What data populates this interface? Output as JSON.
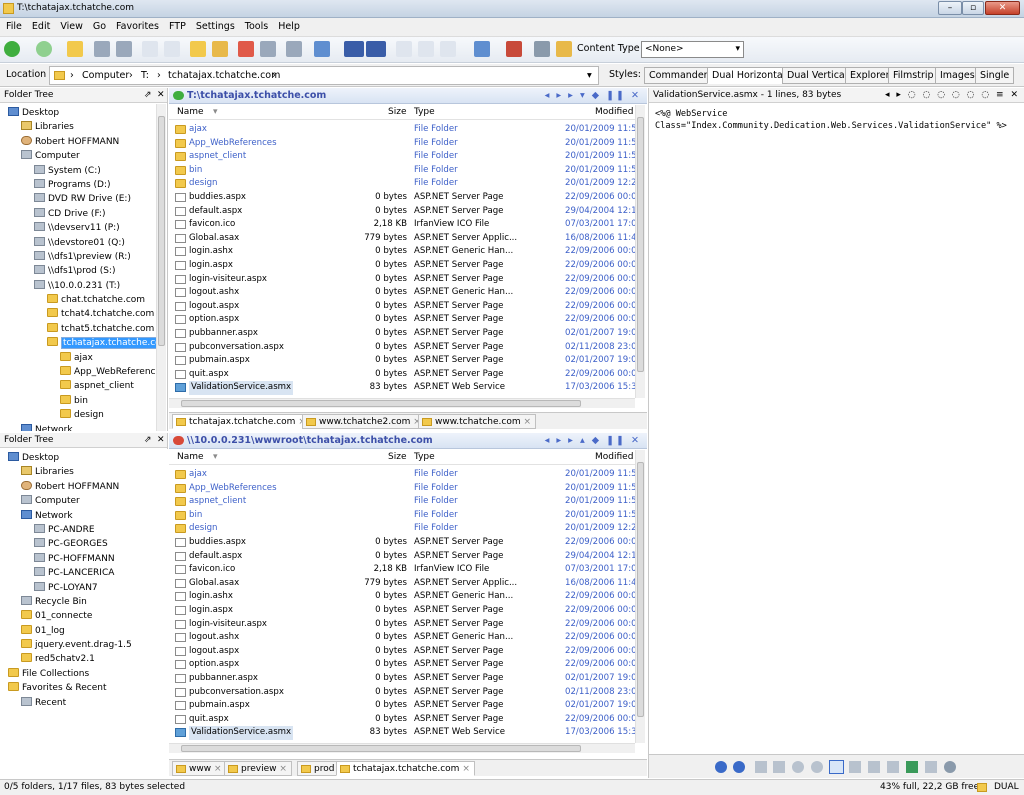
{
  "window": {
    "title": "T:\\tchatajax.tchatche.com",
    "min_label": "–",
    "max_label": "▫",
    "close_label": "✕"
  },
  "menu": [
    "File",
    "Edit",
    "View",
    "Go",
    "Favorites",
    "FTP",
    "Settings",
    "Tools",
    "Help"
  ],
  "toolbar": {
    "content_type_label": "Content Type",
    "content_type_value": "<None>"
  },
  "location": {
    "label": "Location",
    "crumbs": [
      "Computer",
      "T:",
      "tchatajax.tchatche.com"
    ]
  },
  "styles": {
    "label": "Styles:",
    "items": [
      "Commander",
      "Dual Horizontal",
      "Dual Vertical",
      "Explorer",
      "Filmstrip",
      "Images",
      "Single"
    ],
    "active": "Dual Horizontal"
  },
  "tree_top": {
    "title": "Folder Tree",
    "items": [
      {
        "label": "Desktop",
        "icon": "desktop",
        "indent": 0
      },
      {
        "label": "Libraries",
        "icon": "library",
        "indent": 1
      },
      {
        "label": "Robert HOFFMANN",
        "icon": "user",
        "indent": 1
      },
      {
        "label": "Computer",
        "icon": "computer",
        "indent": 1
      },
      {
        "label": "System (C:)",
        "icon": "drive",
        "indent": 2
      },
      {
        "label": "Programs (D:)",
        "icon": "drive",
        "indent": 2
      },
      {
        "label": "DVD RW Drive (E:)",
        "icon": "drive",
        "indent": 2
      },
      {
        "label": "CD Drive (F:)",
        "icon": "drive",
        "indent": 2
      },
      {
        "label": "\\\\devserv11 (P:)",
        "icon": "network-drive",
        "indent": 2
      },
      {
        "label": "\\\\devstore01 (Q:)",
        "icon": "network-drive",
        "indent": 2
      },
      {
        "label": "\\\\dfs1\\preview (R:)",
        "icon": "network-drive",
        "indent": 2
      },
      {
        "label": "\\\\dfs1\\prod (S:)",
        "icon": "network-drive",
        "indent": 2
      },
      {
        "label": "\\\\10.0.0.231 (T:)",
        "icon": "network-drive",
        "indent": 2
      },
      {
        "label": "chat.tchatche.com",
        "icon": "folder",
        "indent": 3
      },
      {
        "label": "tchat4.tchatche.com",
        "icon": "folder",
        "indent": 3
      },
      {
        "label": "tchat5.tchatche.com",
        "icon": "folder",
        "indent": 3
      },
      {
        "label": "tchatajax.tchatche.com",
        "icon": "folder",
        "indent": 3,
        "selected": true
      },
      {
        "label": "ajax",
        "icon": "folder",
        "indent": 4
      },
      {
        "label": "App_WebReferences",
        "icon": "folder",
        "indent": 4
      },
      {
        "label": "aspnet_client",
        "icon": "folder",
        "indent": 4
      },
      {
        "label": "bin",
        "icon": "folder",
        "indent": 4
      },
      {
        "label": "design",
        "icon": "folder",
        "indent": 4
      },
      {
        "label": "Network",
        "icon": "network",
        "indent": 1
      }
    ]
  },
  "tree_bottom": {
    "title": "Folder Tree",
    "items": [
      {
        "label": "Desktop",
        "icon": "desktop",
        "indent": 0
      },
      {
        "label": "Libraries",
        "icon": "library",
        "indent": 1
      },
      {
        "label": "Robert HOFFMANN",
        "icon": "user",
        "indent": 1
      },
      {
        "label": "Computer",
        "icon": "computer",
        "indent": 1
      },
      {
        "label": "Network",
        "icon": "network",
        "indent": 1
      },
      {
        "label": "PC-ANDRE",
        "icon": "computer",
        "indent": 2
      },
      {
        "label": "PC-GEORGES",
        "icon": "computer",
        "indent": 2
      },
      {
        "label": "PC-HOFFMANN",
        "icon": "computer",
        "indent": 2
      },
      {
        "label": "PC-LANCERICA",
        "icon": "computer",
        "indent": 2
      },
      {
        "label": "PC-LOYAN7",
        "icon": "computer",
        "indent": 2
      },
      {
        "label": "Recycle Bin",
        "icon": "recycle",
        "indent": 1
      },
      {
        "label": "01_connecte",
        "icon": "folder",
        "indent": 1
      },
      {
        "label": "01_log",
        "icon": "folder",
        "indent": 1
      },
      {
        "label": "jquery.event.drag-1.5",
        "icon": "folder",
        "indent": 1
      },
      {
        "label": "red5chatv2.1",
        "icon": "folder",
        "indent": 1
      },
      {
        "label": "File Collections",
        "icon": "folder",
        "indent": 0
      },
      {
        "label": "Favorites & Recent",
        "icon": "star",
        "indent": 0
      },
      {
        "label": "Recent",
        "icon": "recent",
        "indent": 1
      }
    ]
  },
  "columns": {
    "name": "Name",
    "size": "Size",
    "type": "Type",
    "modified": "Modified"
  },
  "pane_top": {
    "path": "T:\\tchatajax.tchatche.com",
    "tabs": [
      "tchatajax.tchatche.com",
      "www.tchatche2.com",
      "www.tchatche.com"
    ],
    "active_tab": 0
  },
  "pane_bottom": {
    "path": "\\\\10.0.0.231\\wwwroot\\tchatajax.tchatche.com",
    "tabs": [
      "www",
      "preview",
      "prod",
      "tchatajax.tchatche.com"
    ],
    "active_tab": 3
  },
  "files": [
    {
      "name": "ajax",
      "size": "",
      "type": "File Folder",
      "modified": "20/01/2009 11:5",
      "folder": true
    },
    {
      "name": "App_WebReferences",
      "size": "",
      "type": "File Folder",
      "modified": "20/01/2009 11:5",
      "folder": true
    },
    {
      "name": "aspnet_client",
      "size": "",
      "type": "File Folder",
      "modified": "20/01/2009 11:5",
      "folder": true
    },
    {
      "name": "bin",
      "size": "",
      "type": "File Folder",
      "modified": "20/01/2009 11:5",
      "folder": true
    },
    {
      "name": "design",
      "size": "",
      "type": "File Folder",
      "modified": "20/01/2009 12:2",
      "folder": true
    },
    {
      "name": "buddies.aspx",
      "size": "0 bytes",
      "type": "ASP.NET Server Page",
      "modified": "22/09/2006 00:0"
    },
    {
      "name": "default.aspx",
      "size": "0 bytes",
      "type": "ASP.NET Server Page",
      "modified": "29/04/2004 12:1"
    },
    {
      "name": "favicon.ico",
      "size": "2,18 KB",
      "type": "IrfanView ICO File",
      "modified": "07/03/2001 17:0"
    },
    {
      "name": "Global.asax",
      "size": "779 bytes",
      "type": "ASP.NET Server Applic...",
      "modified": "16/08/2006 11:4"
    },
    {
      "name": "login.ashx",
      "size": "0 bytes",
      "type": "ASP.NET Generic Han...",
      "modified": "22/09/2006 00:0"
    },
    {
      "name": "login.aspx",
      "size": "0 bytes",
      "type": "ASP.NET Server Page",
      "modified": "22/09/2006 00:0"
    },
    {
      "name": "login-visiteur.aspx",
      "size": "0 bytes",
      "type": "ASP.NET Server Page",
      "modified": "22/09/2006 00:0"
    },
    {
      "name": "logout.ashx",
      "size": "0 bytes",
      "type": "ASP.NET Generic Han...",
      "modified": "22/09/2006 00:0"
    },
    {
      "name": "logout.aspx",
      "size": "0 bytes",
      "type": "ASP.NET Server Page",
      "modified": "22/09/2006 00:0"
    },
    {
      "name": "option.aspx",
      "size": "0 bytes",
      "type": "ASP.NET Server Page",
      "modified": "22/09/2006 00:0"
    },
    {
      "name": "pubbanner.aspx",
      "size": "0 bytes",
      "type": "ASP.NET Server Page",
      "modified": "02/01/2007 19:0"
    },
    {
      "name": "pubconversation.aspx",
      "size": "0 bytes",
      "type": "ASP.NET Server Page",
      "modified": "02/11/2008 23:0"
    },
    {
      "name": "pubmain.aspx",
      "size": "0 bytes",
      "type": "ASP.NET Server Page",
      "modified": "02/01/2007 19:0"
    },
    {
      "name": "quit.aspx",
      "size": "0 bytes",
      "type": "ASP.NET Server Page",
      "modified": "22/09/2006 00:0"
    },
    {
      "name": "ValidationService.asmx",
      "size": "83 bytes",
      "type": "ASP.NET Web Service",
      "modified": "17/03/2006 15:3",
      "selected": true
    }
  ],
  "preview": {
    "header": "ValidationService.asmx - 1 lines, 83 bytes",
    "line1": "<%@ WebService",
    "line2": "Class=\"Index.Community.Dedication.Web.Services.ValidationService\" %>"
  },
  "status": {
    "left": "0/5 folders, 1/17 files, 83 bytes selected",
    "right": "43% full, 22,2 GB free",
    "mode": "DUAL"
  },
  "colors": {
    "folder_text": "#3c5fc8",
    "path_text": "#3c4fa8",
    "selection": "#cce1f8"
  }
}
